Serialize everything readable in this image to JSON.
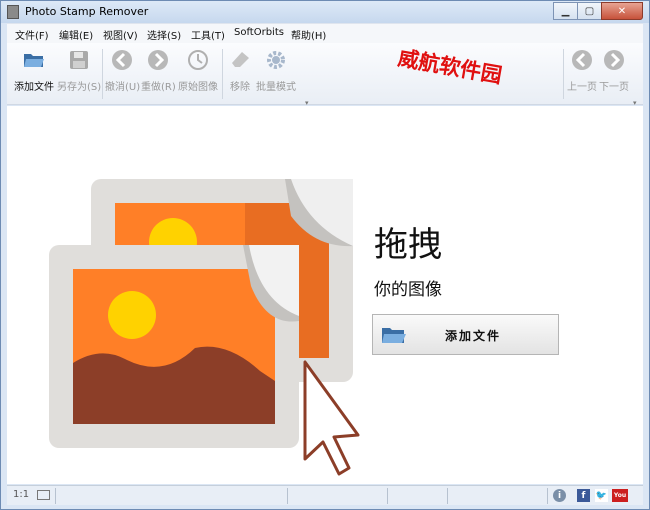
{
  "window": {
    "title": "Photo Stamp Remover"
  },
  "menu": [
    "文件(F)",
    "编辑(E)",
    "视图(V)",
    "选择(S)",
    "工具(T)",
    "SoftOrbits",
    "帮助(H)"
  ],
  "toolbar": {
    "add_file": "添加文件",
    "save_as": "另存为(S)",
    "undo": "撤消(U)",
    "redo": "重做(R)",
    "original": "原始图像",
    "remove": "移除",
    "batch": "批量模式",
    "prev": "上一页",
    "next": "下一页"
  },
  "watermark": "威航软件园",
  "main": {
    "drag_title": "拖拽",
    "drag_sub": "你的图像",
    "add_button": "添加文件"
  },
  "status": {
    "zoom": "1:1"
  },
  "colors": {
    "accent_orange": "#ff7f27",
    "accent_red": "#e01010"
  }
}
